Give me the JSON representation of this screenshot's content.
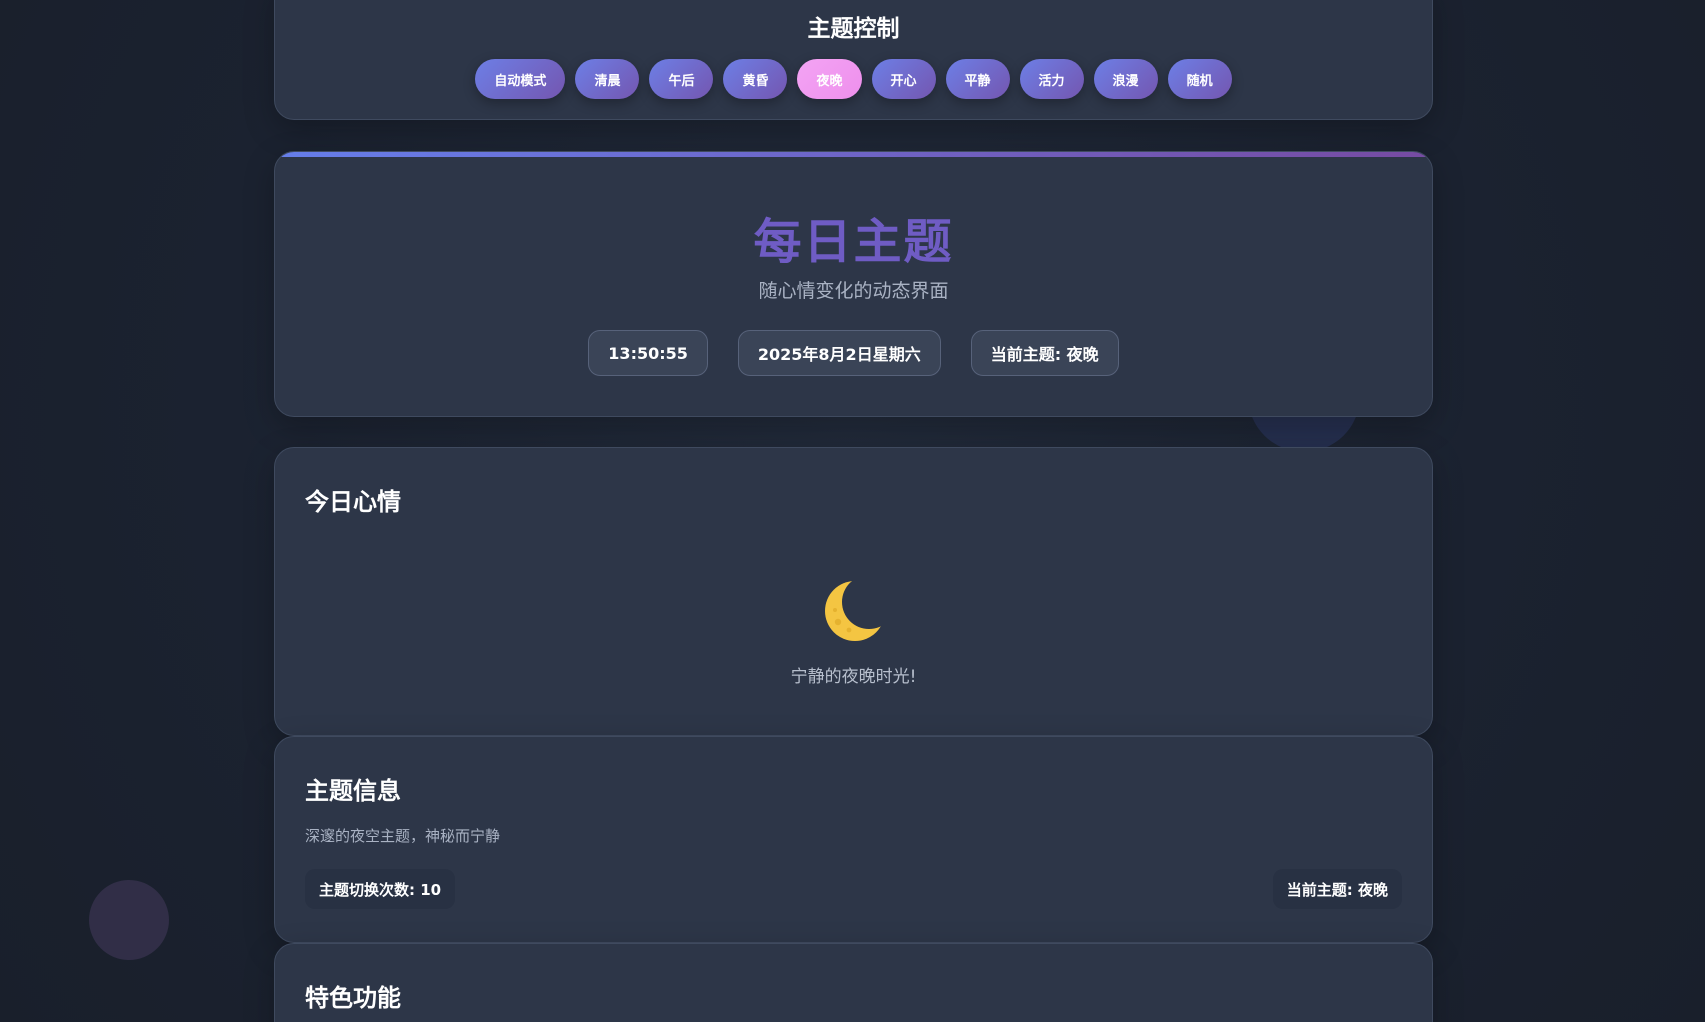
{
  "theme_control": {
    "title": "主题控制",
    "buttons": [
      {
        "label": "自动模式",
        "active": false
      },
      {
        "label": "清晨",
        "active": false
      },
      {
        "label": "午后",
        "active": false
      },
      {
        "label": "黄昏",
        "active": false
      },
      {
        "label": "夜晚",
        "active": true
      },
      {
        "label": "开心",
        "active": false
      },
      {
        "label": "平静",
        "active": false
      },
      {
        "label": "活力",
        "active": false
      },
      {
        "label": "浪漫",
        "active": false
      },
      {
        "label": "随机",
        "active": false
      }
    ]
  },
  "hero": {
    "title": "每日主题",
    "subtitle": "随心情变化的动态界面",
    "time": "13:50:55",
    "date": "2025年8月2日星期六",
    "current_theme": "当前主题: 夜晚"
  },
  "mood": {
    "title": "今日心情",
    "icon": "crescent-moon-icon",
    "text": "宁静的夜晚时光!"
  },
  "info": {
    "title": "主题信息",
    "description": "深邃的夜空主题，神秘而宁静",
    "switch_count": "主题切换次数: 10",
    "current_theme": "当前主题: 夜晚"
  },
  "features": {
    "title": "特色功能"
  },
  "colors": {
    "accent_start": "#667eea",
    "accent_end": "#764ba2",
    "active_button": "#f3a4f4",
    "card_background": "#2d3648",
    "page_background": "#1b2230"
  }
}
